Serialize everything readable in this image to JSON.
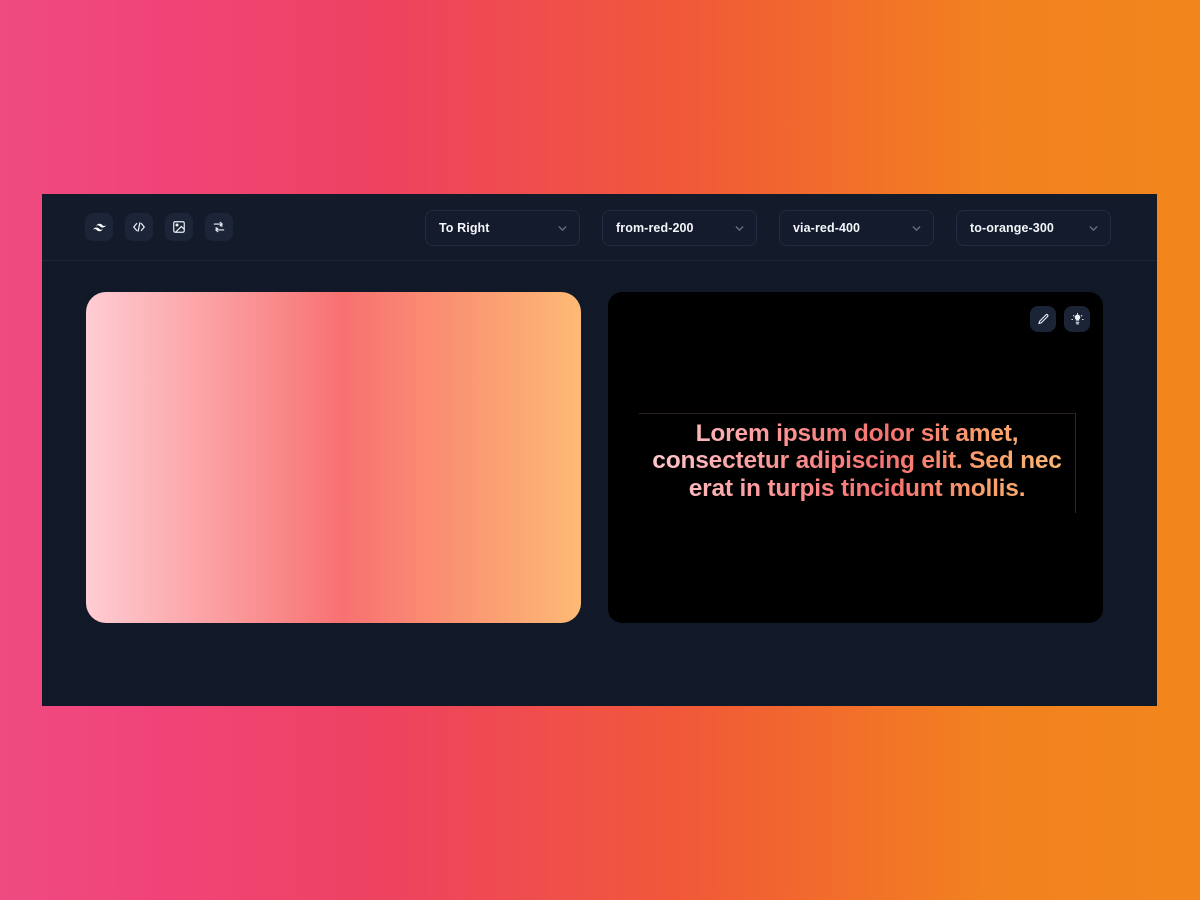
{
  "page": {
    "background_gradient_from": "#ef4b81",
    "background_gradient_via": "#ee4260",
    "background_gradient_to": "#f2861c"
  },
  "toolbar": {
    "icons": [
      {
        "name": "tailwind-logo-icon",
        "label": "Tailwind"
      },
      {
        "name": "code-icon",
        "label": "Code"
      },
      {
        "name": "image-icon",
        "label": "Image"
      },
      {
        "name": "shuffle-icon",
        "label": "Shuffle"
      }
    ],
    "selects": [
      {
        "name": "direction-select",
        "value": "To Right"
      },
      {
        "name": "from-color-select",
        "value": "from-red-200"
      },
      {
        "name": "via-color-select",
        "value": "via-red-400"
      },
      {
        "name": "to-color-select",
        "value": "to-orange-300"
      }
    ]
  },
  "gradient_card": {
    "from": "#fecdd3",
    "via": "#f87171",
    "to": "#fdba74",
    "direction": "to right"
  },
  "preview": {
    "background": "#000000",
    "actions": [
      {
        "name": "edit-button",
        "icon": "pencil-icon"
      },
      {
        "name": "idea-button",
        "icon": "lightbulb-icon"
      }
    ],
    "text": "Lorem ipsum dolor sit amet, consectetur adipiscing elit. Sed nec erat in turpis tincidunt mollis."
  }
}
